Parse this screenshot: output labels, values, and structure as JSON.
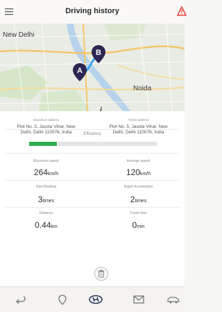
{
  "header": {
    "title": "Driving history",
    "menu_icon": "hamburger-menu-icon",
    "alert_icon": "warning-triangle-icon",
    "accent": "#e2473f"
  },
  "map": {
    "places": [
      "New Delhi",
      "Noida"
    ],
    "markers": [
      {
        "label": "A"
      },
      {
        "label": "B"
      }
    ],
    "info_glyph": "i",
    "marker_color": "#2d2654",
    "route_color": "#3da3e8"
  },
  "departure": {
    "caption": "Departure address",
    "address_line1": "Plot No. 5, Jasola Vihar, New",
    "address_line2": "Delhi, Delhi 110076, India"
  },
  "arrival": {
    "caption": "Arrival address",
    "address_line1": "Plot No. 5, Jasola Vihar, New",
    "address_line2": "Delhi, Delhi 110076, India"
  },
  "efficiency": {
    "label": "Efficiency",
    "level_fraction": 0.22,
    "color": "#2eae4f"
  },
  "metrics": {
    "max_speed": {
      "label": "Maximum speed",
      "value": "264",
      "unit": "km/h"
    },
    "avg_speed": {
      "label": "Average speed",
      "value": "120",
      "unit": "km/h"
    },
    "hard_braking": {
      "label": "Hard Braking",
      "value": "3",
      "unit": "times"
    },
    "rapid_acceleration": {
      "label": "Rapid Acceleration",
      "value": "2",
      "unit": "times"
    },
    "distance": {
      "label": "Distance",
      "value": "0.44",
      "unit": "km"
    },
    "travel_time": {
      "label": "Travel time",
      "value": "0",
      "unit": "min"
    }
  },
  "actions": {
    "delete_icon": "trash-icon"
  },
  "bottom_nav": {
    "items": [
      "back-icon",
      "location-pin-icon",
      "hyundai-logo-icon",
      "mail-icon",
      "car-side-icon"
    ]
  }
}
